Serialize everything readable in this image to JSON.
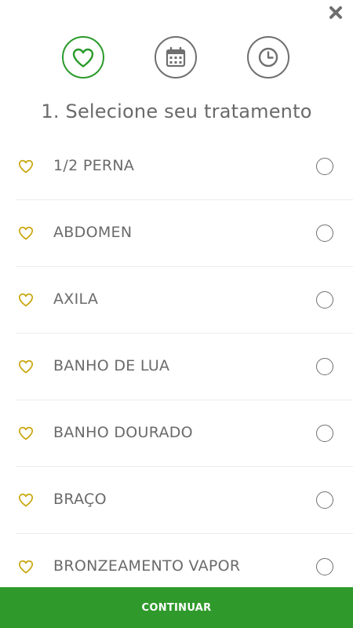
{
  "header": {
    "close_icon": "close-x-icon",
    "steps": [
      {
        "icon": "heart-icon",
        "state": "active",
        "color": "#2a9a2a"
      },
      {
        "icon": "calendar-icon",
        "state": "inactive",
        "color": "#6f6f6f"
      },
      {
        "icon": "clock-icon",
        "state": "inactive",
        "color": "#6f6f6f"
      }
    ]
  },
  "title": "1. Selecione seu tratamento",
  "treatments": [
    {
      "label": "1/2 PERNA",
      "icon": "heart-outline-icon",
      "selected": false
    },
    {
      "label": "ABDOMEN",
      "icon": "heart-outline-icon",
      "selected": false
    },
    {
      "label": "AXILA",
      "icon": "heart-outline-icon",
      "selected": false
    },
    {
      "label": "BANHO DE LUA",
      "icon": "heart-outline-icon",
      "selected": false
    },
    {
      "label": "BANHO DOURADO",
      "icon": "heart-outline-icon",
      "selected": false
    },
    {
      "label": "BRAÇO",
      "icon": "heart-outline-icon",
      "selected": false
    },
    {
      "label": "BRONZEAMENTO VAPOR",
      "icon": "heart-outline-icon",
      "selected": false
    }
  ],
  "footer": {
    "continue_label": "CONTINUAR"
  },
  "colors": {
    "accent_green": "#2f9a2b",
    "heart_gold": "#c9a40a",
    "text_gray": "#6a6a6a"
  }
}
